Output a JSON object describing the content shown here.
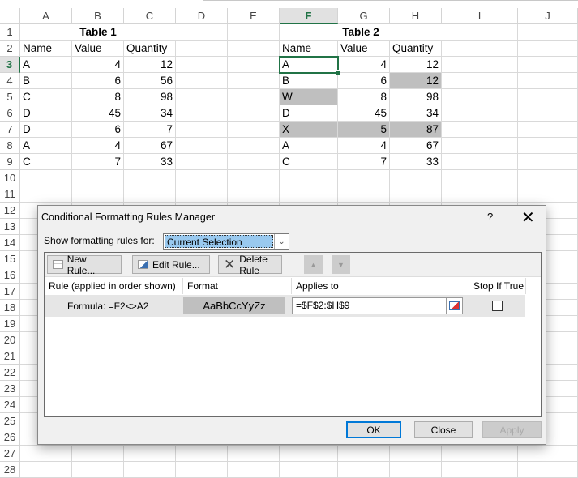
{
  "columns": [
    "A",
    "B",
    "C",
    "D",
    "E",
    "F",
    "G",
    "H",
    "I",
    "J"
  ],
  "selected_column": "F",
  "selected_row": 3,
  "rows": [
    1,
    2,
    3,
    4,
    5,
    6,
    7,
    8,
    9,
    10,
    11,
    12,
    13,
    14,
    15,
    16,
    17,
    18,
    19,
    20,
    21,
    22,
    23,
    24,
    25,
    26,
    27,
    28
  ],
  "table1": {
    "title": "Table 1",
    "headers": [
      "Name",
      "Value",
      "Quantity"
    ],
    "rows": [
      [
        "A",
        4,
        12
      ],
      [
        "B",
        6,
        56
      ],
      [
        "C",
        8,
        98
      ],
      [
        "D",
        45,
        34
      ],
      [
        "D",
        6,
        7
      ],
      [
        "A",
        4,
        67
      ],
      [
        "C",
        7,
        33
      ]
    ]
  },
  "table2": {
    "title": "Table 2",
    "headers": [
      "Name",
      "Value",
      "Quantity"
    ],
    "rows": [
      [
        "A",
        4,
        12
      ],
      [
        "B",
        6,
        12
      ],
      [
        "W",
        8,
        98
      ],
      [
        "D",
        45,
        34
      ],
      [
        "X",
        5,
        87
      ],
      [
        "A",
        4,
        67
      ],
      [
        "C",
        7,
        33
      ]
    ],
    "highlighted_cells": [
      [
        1,
        2
      ],
      [
        2,
        0
      ],
      [
        4,
        0
      ],
      [
        4,
        1
      ],
      [
        4,
        2
      ]
    ],
    "highlight_color": "#bfbfbf"
  },
  "dialog": {
    "title": "Conditional Formatting Rules Manager",
    "help": "?",
    "close": "✕",
    "show_rules_label": "Show formatting rules for:",
    "show_rules_value": "Current Selection",
    "toolbar": {
      "new_rule": "New Rule...",
      "edit_rule": "Edit Rule...",
      "delete_rule": "Delete Rule",
      "move_up": "▲",
      "move_down": "▼"
    },
    "columns": [
      "Rule (applied in order shown)",
      "Format",
      "Applies to",
      "Stop If True"
    ],
    "rules": [
      {
        "rule": "Formula: =F2<>A2",
        "format_preview": "AaBbCcYyZz",
        "applies_to": "=$F$2:$H$9",
        "stop_if_true": false
      }
    ],
    "buttons": {
      "ok": "OK",
      "close": "Close",
      "apply": "Apply"
    }
  }
}
